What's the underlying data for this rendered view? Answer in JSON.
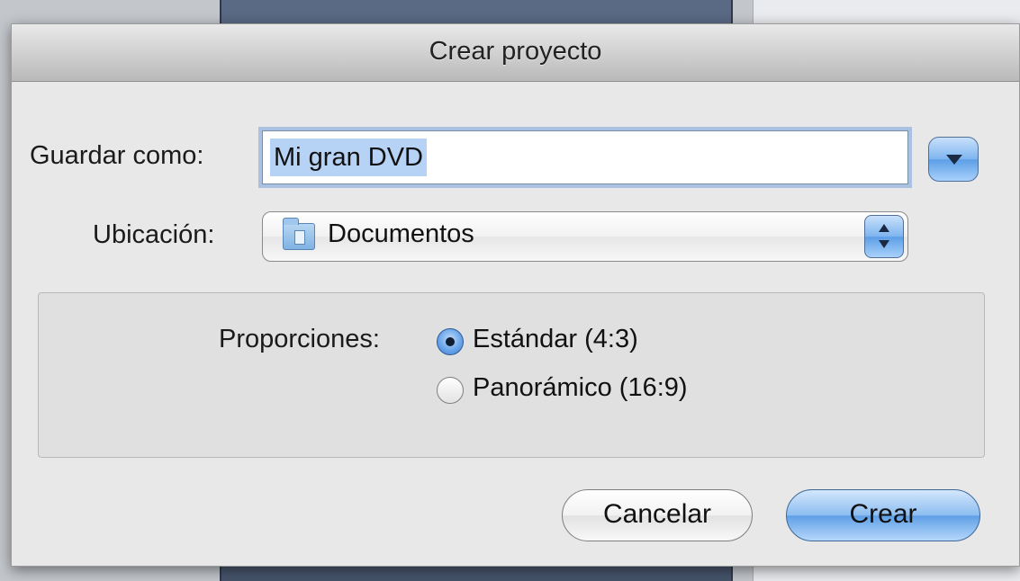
{
  "dialog": {
    "title": "Crear proyecto"
  },
  "form": {
    "save_as_label": "Guardar como:",
    "save_as_value": "Mi gran DVD",
    "location_label": "Ubicación:",
    "location_value": "Documentos"
  },
  "aspect": {
    "label": "Proporciones:",
    "options": [
      {
        "label": "Estándar (4:3)",
        "selected": true
      },
      {
        "label": "Panorámico (16:9)",
        "selected": false
      }
    ]
  },
  "buttons": {
    "cancel_label": "Cancelar",
    "create_label": "Crear"
  },
  "colors": {
    "accent": "#5f9fe6",
    "selection": "#b6d3f6"
  },
  "icons": {
    "expand": "chevron-down-icon",
    "folder": "folder-icon",
    "stepper": "updown-stepper-icon"
  }
}
